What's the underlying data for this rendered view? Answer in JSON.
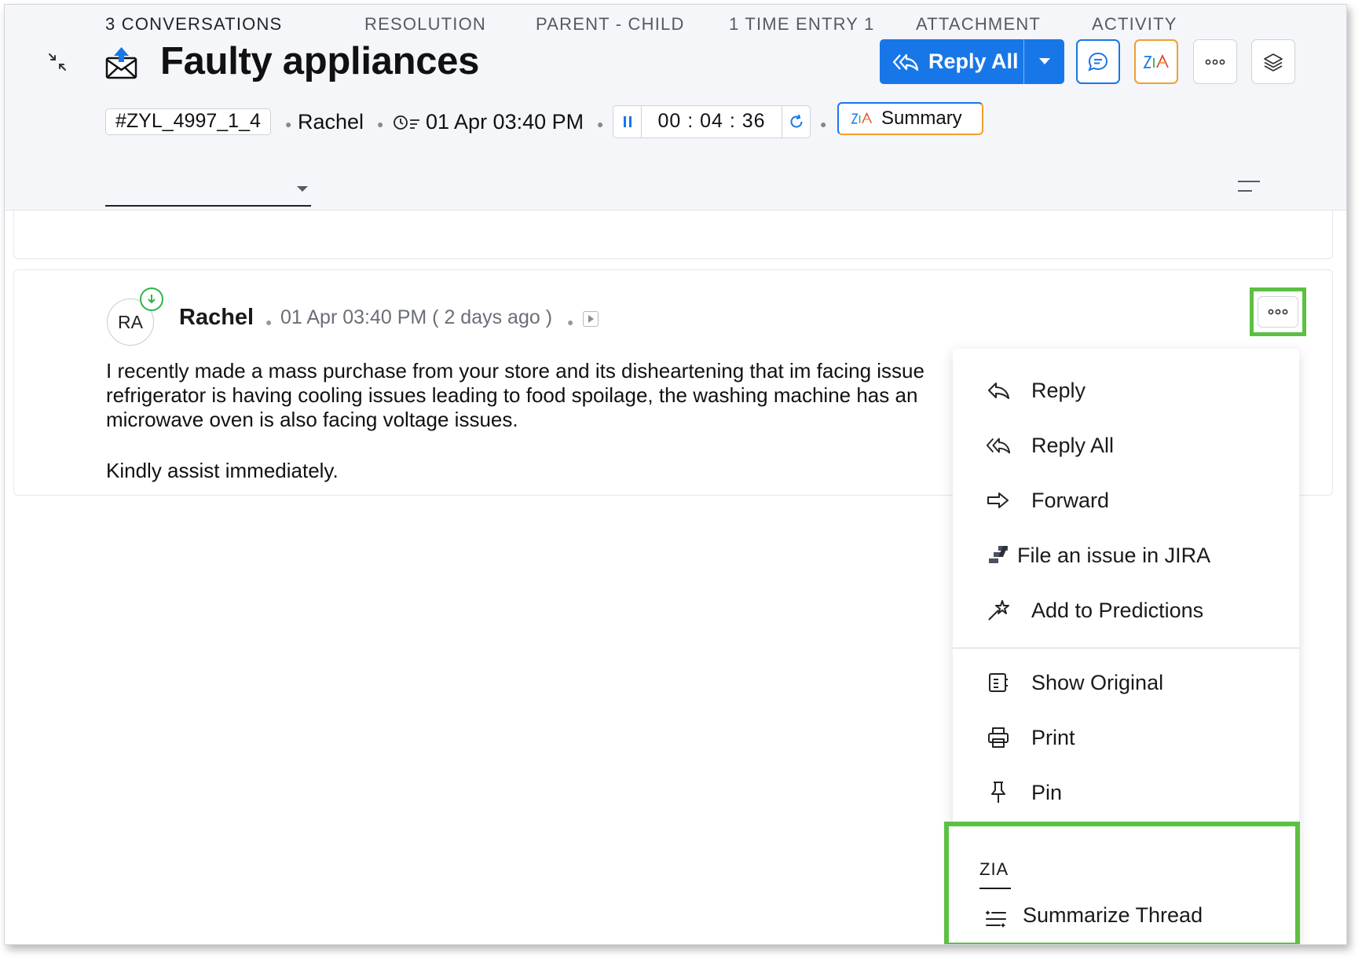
{
  "ticket": {
    "title": "Faulty appliances",
    "id": "#ZYL_4997_1_4",
    "contact": "Rachel",
    "created": "01 Apr 03:40 PM",
    "timer": "00 : 04 : 36"
  },
  "header": {
    "reply_all_label": "Reply All",
    "summary_label": "Summary",
    "zia_glyph": "Zia"
  },
  "tabs": [
    {
      "label": "3 CONVERSATIONS",
      "active": true
    },
    {
      "label": "RESOLUTION"
    },
    {
      "label": "PARENT - CHILD"
    },
    {
      "label": "1 TIME ENTRY 1"
    },
    {
      "label": "ATTACHMENT"
    },
    {
      "label": "ACTIVITY"
    }
  ],
  "conversation": {
    "avatar_initials": "RA",
    "sender": "Rachel",
    "timestamp": "01 Apr 03:40 PM ( 2 days ago )",
    "body_lines": [
      "I recently made a mass purchase from your store and its disheartening that im facing issue",
      "refrigerator is having cooling issues leading to food spoilage, the washing machine has an",
      "microwave oven is also facing voltage issues."
    ],
    "signoff": "Kindly assist immediately."
  },
  "menu": {
    "items": [
      {
        "label": "Reply",
        "icon": "reply-icon"
      },
      {
        "label": "Reply All",
        "icon": "reply-all-icon"
      },
      {
        "label": "Forward",
        "icon": "forward-icon"
      },
      {
        "label": "File an issue in JIRA",
        "icon": "jira-icon"
      },
      {
        "label": "Add to Predictions",
        "icon": "magic-wand-icon"
      },
      {
        "label": "Show Original",
        "icon": "document-icon"
      },
      {
        "label": "Print",
        "icon": "printer-icon"
      },
      {
        "label": "Pin",
        "icon": "pin-icon"
      }
    ],
    "zia_section": {
      "heading": "ZIA",
      "item": {
        "label": "Summarize Thread",
        "icon": "summarize-icon"
      }
    }
  },
  "colors": {
    "primary": "#1877e8",
    "highlight": "#5cc043",
    "zia_orange": "#f0a030",
    "status_green": "#2fb34a"
  }
}
